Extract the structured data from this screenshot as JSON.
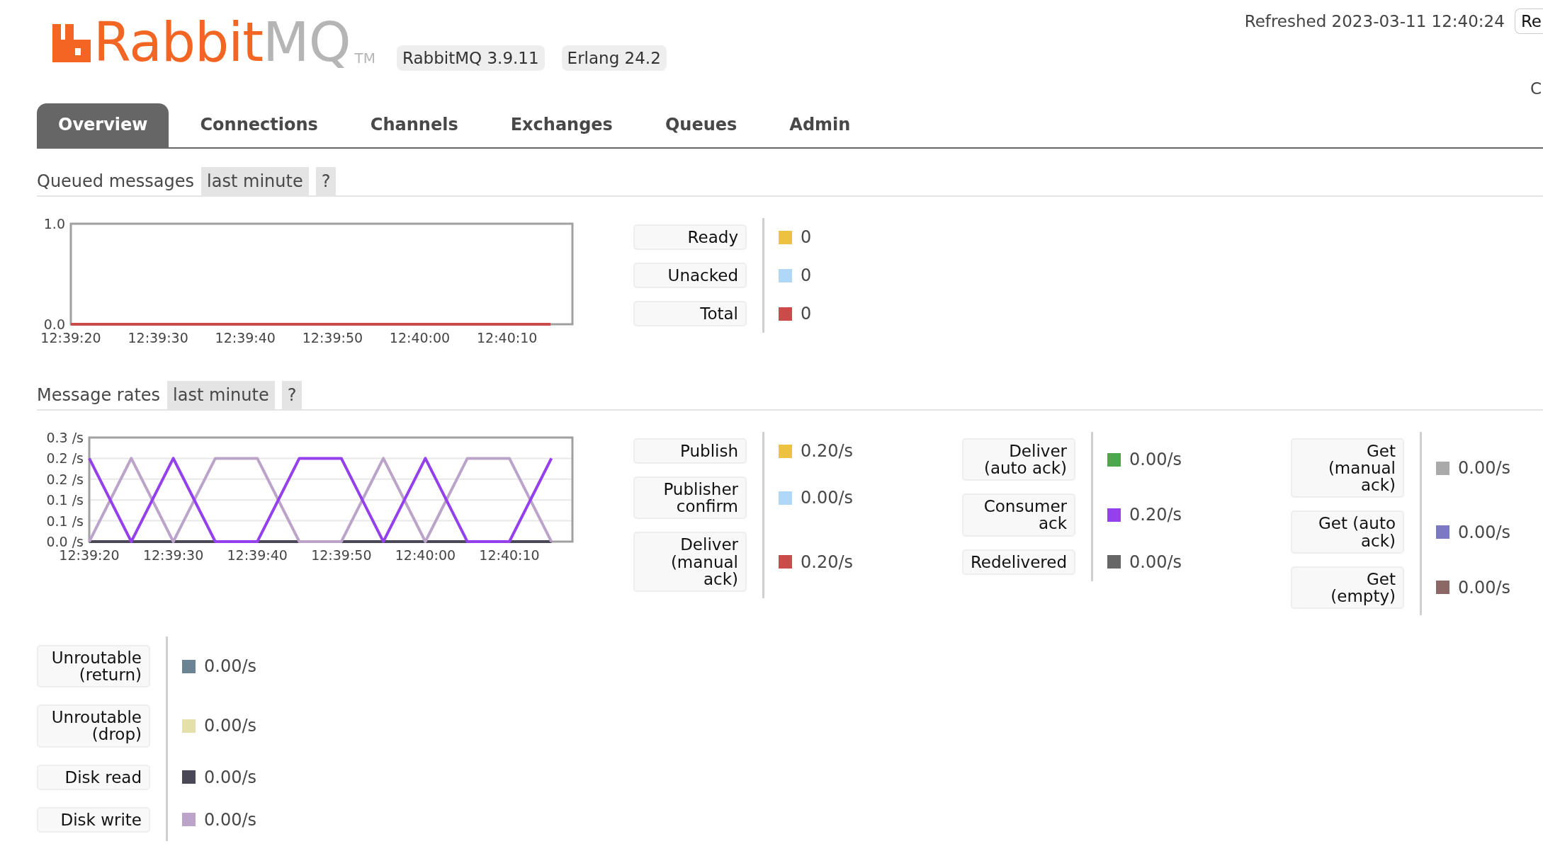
{
  "header": {
    "logo": {
      "brand": "Rabbit",
      "suffix": "MQ",
      "trademark": "TM"
    },
    "versions": [
      "RabbitMQ 3.9.11",
      "Erlang 24.2"
    ],
    "refreshed": "Refreshed 2023-03-11 12:40:24",
    "refresh_button": "Re",
    "cut_text": "C"
  },
  "tabs": [
    {
      "label": "Overview",
      "selected": true
    },
    {
      "label": "Connections",
      "selected": false
    },
    {
      "label": "Channels",
      "selected": false
    },
    {
      "label": "Exchanges",
      "selected": false
    },
    {
      "label": "Queues",
      "selected": false
    },
    {
      "label": "Admin",
      "selected": false
    }
  ],
  "sections": [
    {
      "title": "Queued messages",
      "period": "last minute",
      "help": "?",
      "chart_data": {
        "type": "line",
        "x": [
          45560,
          45565,
          45570,
          45575,
          45580,
          45585,
          45590,
          45595,
          45600,
          45605,
          45610,
          45615
        ],
        "xlim": [
          45560,
          45617.5
        ],
        "xticks": [
          {
            "value": 45560,
            "label": "12:39:20"
          },
          {
            "value": 45570,
            "label": "12:39:30"
          },
          {
            "value": 45580,
            "label": "12:39:40"
          },
          {
            "value": 45590,
            "label": "12:39:50"
          },
          {
            "value": 45600,
            "label": "12:40:00"
          },
          {
            "value": 45610,
            "label": "12:40:10"
          }
        ],
        "ylim": [
          0,
          1
        ],
        "yticks": [
          {
            "value": 0,
            "label": "0.0"
          },
          {
            "value": 1,
            "label": "1.0"
          }
        ],
        "series": [
          {
            "color": "#cb4b4b",
            "values": [
              0,
              0,
              0,
              0,
              0,
              0,
              0,
              0,
              0,
              0,
              0,
              0
            ]
          }
        ]
      },
      "legend_groups": [
        [
          {
            "label": "Ready",
            "value": "0",
            "color": "#edc240"
          },
          {
            "label": "Unacked",
            "value": "0",
            "color": "#afd8f8"
          },
          {
            "label": "Total",
            "value": "0",
            "color": "#cb4b4b"
          }
        ]
      ]
    },
    {
      "title": "Message rates",
      "period": "last minute",
      "help": "?",
      "chart_data": {
        "type": "line",
        "grid": true,
        "x": [
          45560,
          45565,
          45570,
          45575,
          45580,
          45585,
          45590,
          45595,
          45600,
          45605,
          45610,
          45615
        ],
        "xlim": [
          45560,
          45617.5
        ],
        "xticks": [
          {
            "value": 45560,
            "label": "12:39:20"
          },
          {
            "value": 45570,
            "label": "12:39:30"
          },
          {
            "value": 45580,
            "label": "12:39:40"
          },
          {
            "value": 45590,
            "label": "12:39:50"
          },
          {
            "value": 45600,
            "label": "12:40:00"
          },
          {
            "value": 45610,
            "label": "12:40:10"
          }
        ],
        "ylim": [
          0,
          0.25
        ],
        "yticks": [
          {
            "value": 0,
            "label": "0.0 /s"
          },
          {
            "value": 0.05,
            "label": "0.1 /s"
          },
          {
            "value": 0.1,
            "label": "0.1 /s"
          },
          {
            "value": 0.15,
            "label": "0.2 /s"
          },
          {
            "value": 0.2,
            "label": "0.2 /s"
          },
          {
            "value": 0.25,
            "label": "0.3 /s"
          }
        ],
        "series": [
          {
            "color": "#4a4856",
            "values": [
              0,
              0,
              0,
              0,
              0,
              0,
              0,
              0,
              0,
              0,
              0,
              0
            ]
          },
          {
            "color": "#bca3c9",
            "values": [
              0,
              0.2,
              0,
              0.2,
              0.2,
              0,
              0,
              0.2,
              0,
              0.2,
              0.2,
              0
            ]
          },
          {
            "color": "#9440ed",
            "values": [
              0.2,
              0,
              0.2,
              0,
              0,
              0.2,
              0.2,
              0,
              0.2,
              0,
              0,
              0.2
            ]
          }
        ]
      },
      "legend_groups": [
        [
          {
            "label": "Publish",
            "value": "0.20/s",
            "color": "#edc240"
          },
          {
            "label": "Publisher confirm",
            "value": "0.00/s",
            "color": "#afd8f8"
          },
          {
            "label": "Deliver (manual ack)",
            "value": "0.20/s",
            "color": "#cb4b4b"
          }
        ],
        [
          {
            "label": "Deliver (auto ack)",
            "value": "0.00/s",
            "color": "#4da74d"
          },
          {
            "label": "Consumer ack",
            "value": "0.20/s",
            "color": "#9440ed"
          },
          {
            "label": "Redelivered",
            "value": "0.00/s",
            "color": "#666666"
          }
        ],
        [
          {
            "label": "Get (manual ack)",
            "value": "0.00/s",
            "color": "#aaaaaa"
          },
          {
            "label": "Get (auto ack)",
            "value": "0.00/s",
            "color": "#7c79c3"
          },
          {
            "label": "Get (empty)",
            "value": "0.00/s",
            "color": "#8b6766"
          }
        ]
      ]
    }
  ],
  "extra_rates": [
    {
      "label": "Unroutable (return)",
      "value": "0.00/s",
      "color": "#6b8493"
    },
    {
      "label": "Unroutable (drop)",
      "value": "0.00/s",
      "color": "#e3e0a9"
    },
    {
      "label": "Disk read",
      "value": "0.00/s",
      "color": "#4a4856"
    },
    {
      "label": "Disk write",
      "value": "0.00/s",
      "color": "#bca3c9"
    }
  ]
}
